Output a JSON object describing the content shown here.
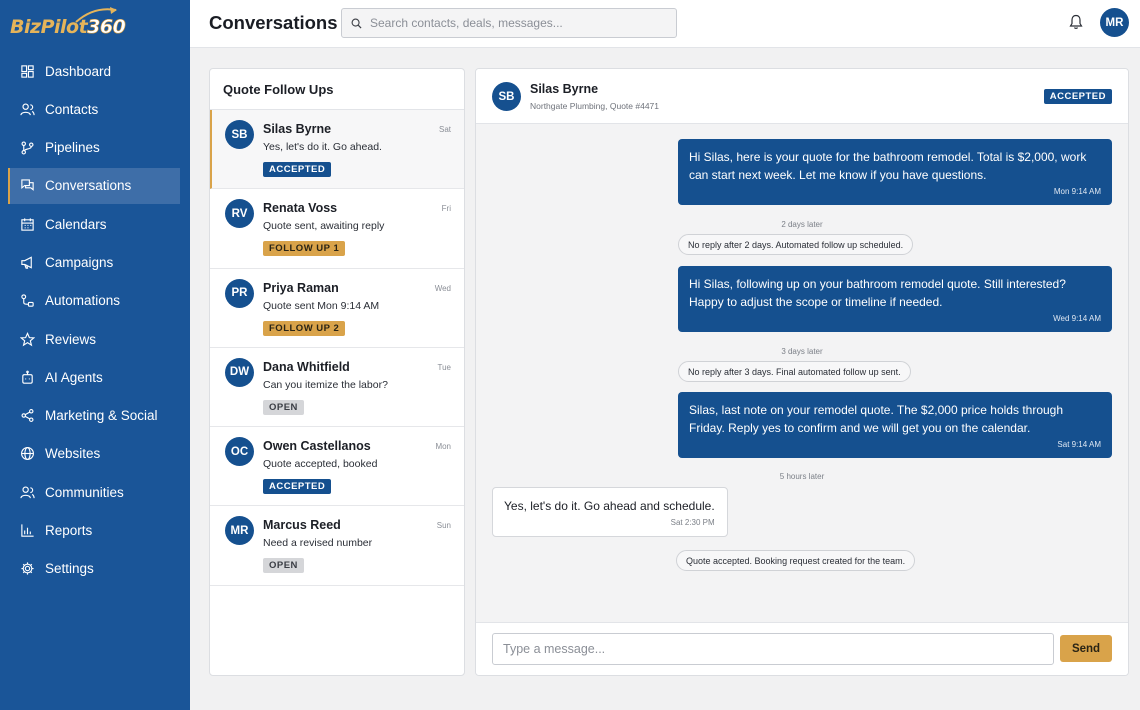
{
  "brand": {
    "name_part1": "Biz",
    "name_part2": "Pilot",
    "name_part3": "360"
  },
  "sidebar": {
    "items": [
      {
        "label": "Dashboard",
        "icon": "dashboard-icon"
      },
      {
        "label": "Contacts",
        "icon": "contacts-icon"
      },
      {
        "label": "Pipelines",
        "icon": "pipelines-icon"
      },
      {
        "label": "Conversations",
        "icon": "conversations-icon",
        "active": true
      },
      {
        "label": "Calendars",
        "icon": "calendar-icon"
      },
      {
        "label": "Campaigns",
        "icon": "megaphone-icon"
      },
      {
        "label": "Automations",
        "icon": "automations-icon"
      },
      {
        "label": "Reviews",
        "icon": "star-icon"
      },
      {
        "label": "AI Agents",
        "icon": "robot-icon"
      },
      {
        "label": "Marketing & Social",
        "icon": "share-icon"
      },
      {
        "label": "Websites",
        "icon": "globe-icon"
      },
      {
        "label": "Communities",
        "icon": "users-icon"
      },
      {
        "label": "Reports",
        "icon": "chart-icon"
      },
      {
        "label": "Settings",
        "icon": "gear-icon"
      }
    ]
  },
  "header": {
    "title": "Conversations",
    "search_placeholder": "Search contacts, deals, messages...",
    "user_initials": "MR"
  },
  "list": {
    "title": "Quote Follow Ups",
    "conversations": [
      {
        "initials": "SB",
        "name": "Silas Byrne",
        "day": "Sat",
        "preview": "Yes, let's do it. Go ahead.",
        "badge": "ACCEPTED",
        "badge_type": "accepted",
        "active": true
      },
      {
        "initials": "RV",
        "name": "Renata Voss",
        "day": "Fri",
        "preview": "Quote sent, awaiting reply",
        "badge": "FOLLOW UP 1",
        "badge_type": "follow"
      },
      {
        "initials": "PR",
        "name": "Priya Raman",
        "day": "Wed",
        "preview": "Quote sent Mon 9:14 AM",
        "badge": "FOLLOW UP 2",
        "badge_type": "follow"
      },
      {
        "initials": "DW",
        "name": "Dana Whitfield",
        "day": "Tue",
        "preview": "Can you itemize the labor?",
        "badge": "OPEN",
        "badge_type": "open"
      },
      {
        "initials": "OC",
        "name": "Owen Castellanos",
        "day": "Mon",
        "preview": "Quote accepted, booked",
        "badge": "ACCEPTED",
        "badge_type": "accepted"
      },
      {
        "initials": "MR",
        "name": "Marcus Reed",
        "day": "Sun",
        "preview": "Need a revised number",
        "badge": "OPEN",
        "badge_type": "open"
      }
    ]
  },
  "thread": {
    "initials": "SB",
    "name": "Silas Byrne",
    "subtitle": "Northgate Plumbing, Quote #4471",
    "status": "ACCEPTED",
    "messages": [
      {
        "text": "Hi Silas, here is your quote for the bathroom remodel. Total is $2,000, work can start next week. Let me know if you have questions.",
        "time": "Mon 9:14 AM"
      },
      {
        "gap": "2 days later"
      },
      {
        "note": "No reply after 2 days. Automated follow up scheduled."
      },
      {
        "text": "Hi Silas, following up on your bathroom remodel quote. Still interested? Happy to adjust the scope or timeline if needed.",
        "time": "Wed 9:14 AM"
      },
      {
        "gap": "3 days later"
      },
      {
        "note": "No reply after 3 days. Final automated follow up sent."
      },
      {
        "text": "Silas, last note on your remodel quote. The $2,000 price holds through Friday. Reply yes to confirm and we will get you on the calendar.",
        "time": "Sat 9:14 AM"
      },
      {
        "gap": "5 hours later"
      },
      {
        "text": "Yes, let's do it. Go ahead and schedule.",
        "time": "Sat 2:30 PM"
      },
      {
        "note": "Quote accepted. Booking request created for the team."
      }
    ],
    "composer_placeholder": "Type a message...",
    "send_label": "Send"
  },
  "colors": {
    "primary": "#15508f",
    "sidebar": "#1a5598",
    "accent": "#d9a34a",
    "neutral_badge": "#d5d6d9"
  }
}
